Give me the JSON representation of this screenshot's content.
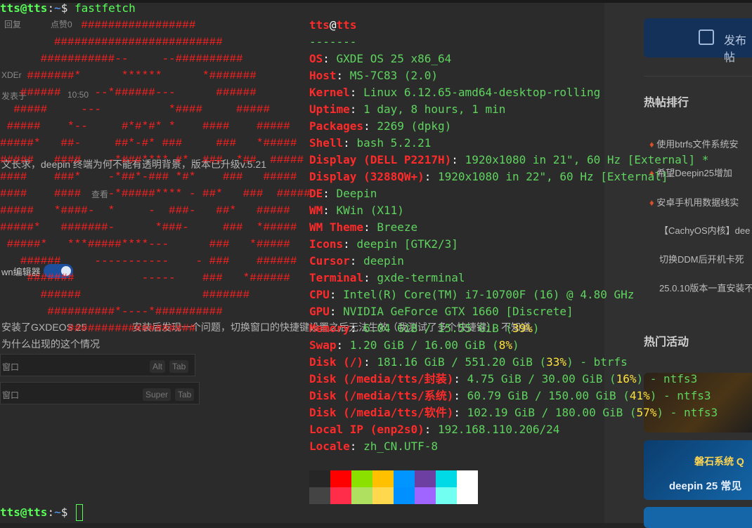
{
  "terminal": {
    "user": "tts@tts",
    "path": "~",
    "symbol": "$",
    "command": "fastfetch"
  },
  "logo_lines": [
    "            #################",
    "        #########################",
    "      ###########--     --##########",
    "    #######*      ******      *#######",
    "   ######     --*######---      ######",
    "  #####     ---          *####     #####",
    " #####    *--     #*#*#* *    ####    #####",
    "#####*   ##-     ##*-#* ###     ###   *#####",
    "#####   ####    -*###**** #*  ###  *##  #####",
    "####    ###*    -*##*-### *#*    ###   #####",
    "####    ####    -*#####**** - ##*   ###  #####",
    "#####   *####-  *     -  ###-   ##*   #####",
    "#####*   #######-      *###-     ###  *#####",
    " #####*   ***#####****---      ###   *#####",
    "   ######     -----------    - ###    ######",
    "    #######          -----    ###   *######",
    "      ######                  #######",
    "       ##########*----*##########",
    "          ###################"
  ],
  "info": {
    "header_user": "tts",
    "header_at": "@",
    "header_host": "tts",
    "separator": "-------",
    "rows": [
      {
        "key": "OS",
        "value": "GXDE OS 25 x86_64"
      },
      {
        "key": "Host",
        "value": "MS-7C83 (2.0)"
      },
      {
        "key": "Kernel",
        "value": "Linux 6.12.65-amd64-desktop-rolling"
      },
      {
        "key": "Uptime",
        "value": "1 day, 8 hours, 1 min"
      },
      {
        "key": "Packages",
        "value": "2269 (dpkg)"
      },
      {
        "key": "Shell",
        "value": "bash 5.2.21"
      },
      {
        "key": "Display (DELL P2217H)",
        "value": "1920x1080 in 21\", 60 Hz [External] *"
      },
      {
        "key": "Display (3288QW+)",
        "value": "1920x1080 in 22\", 60 Hz [External]"
      },
      {
        "key": "DE",
        "value": "Deepin"
      },
      {
        "key": "WM",
        "value": "KWin (X11)"
      },
      {
        "key": "WM Theme",
        "value": "Breeze"
      },
      {
        "key": "Icons",
        "value": "deepin [GTK2/3]"
      },
      {
        "key": "Cursor",
        "value": "deepin"
      },
      {
        "key": "Terminal",
        "value": "gxde-terminal"
      },
      {
        "key": "CPU",
        "value": "Intel(R) Core(TM) i7-10700F (16) @ 4.80 GHz"
      },
      {
        "key": "GPU",
        "value": "NVIDIA GeForce GTX 1660 [Discrete]"
      },
      {
        "key": "Memory",
        "value": "6.04 GiB / 15.55 GiB (",
        "pct": "39%",
        "tail": ")"
      },
      {
        "key": "Swap",
        "value": "1.20 GiB / 16.00 GiB (",
        "pct": "8%",
        "tail": ")"
      },
      {
        "key": "Disk (/)",
        "value": "181.16 GiB / 551.20 GiB (",
        "pct": "33%",
        "tail": ") - btrfs"
      },
      {
        "key": "Disk (/media/tts/封装)",
        "value": "4.75 GiB / 30.00 GiB (",
        "pct": "16%",
        "tail": ") - ntfs3"
      },
      {
        "key": "Disk (/media/tts/系统)",
        "value": "60.79 GiB / 150.00 GiB (",
        "pct": "41%",
        "tail": ") - ntfs3"
      },
      {
        "key": "Disk (/media/tts/软件)",
        "value": "102.19 GiB / 180.00 GiB (",
        "pct": "57%",
        "tail": ") - ntfs3"
      },
      {
        "key": "Local IP (enp2s0)",
        "value": "192.168.110.206/24"
      },
      {
        "key": "Locale",
        "value": "zh_CN.UTF-8"
      }
    ]
  },
  "palette": {
    "top": [
      "#262626",
      "#ff0000",
      "#8ce000",
      "#ffc000",
      "#0095ff",
      "#6e3fa3",
      "#00d9e6",
      "#ffffff"
    ],
    "bottom": [
      "#444444",
      "#ff2d4a",
      "#b0e060",
      "#ffd84d",
      "#0090ff",
      "#a065ff",
      "#70fff0",
      "#ffffff"
    ]
  },
  "background": {
    "left_snippets": {
      "reply": "回复",
      "like": "点赞0",
      "user": "XDEr",
      "posted": "发表于",
      "time": "10:50",
      "question_line": "文长求，deepin 终端为何不能有透明背景，版本已升级v.5.21",
      "views": "查看",
      "editor_toggle": "wn编辑器",
      "body_line1": "安装了GXDEOS 25",
      "body_line2": "安装后发现一个问题，切换窗口的快捷键设置之后无法生效（我测试了多个快捷键），不知道",
      "body_line3": "为什么出现的这个情况",
      "shortcut1_label": "窗口",
      "shortcut1_k1": "Alt",
      "shortcut1_k2": "Tab",
      "shortcut2_label": "窗口",
      "shortcut2_k1": "Super",
      "shortcut2_k2": "Tab"
    },
    "post_button": "发布帖",
    "hot_title": "热帖排行",
    "hot_items": [
      "使用btrfs文件系统安",
      "希望Deepin25增加",
      "安卓手机用数据线实",
      "【CachyOS内核】dee",
      "切换DDM后开机卡死",
      "25.0.10版本一直安装不"
    ],
    "activity_title": "热门活动",
    "banner2_line1": "磐石系统 Q",
    "banner2_line2": "deepin 25 常见"
  }
}
